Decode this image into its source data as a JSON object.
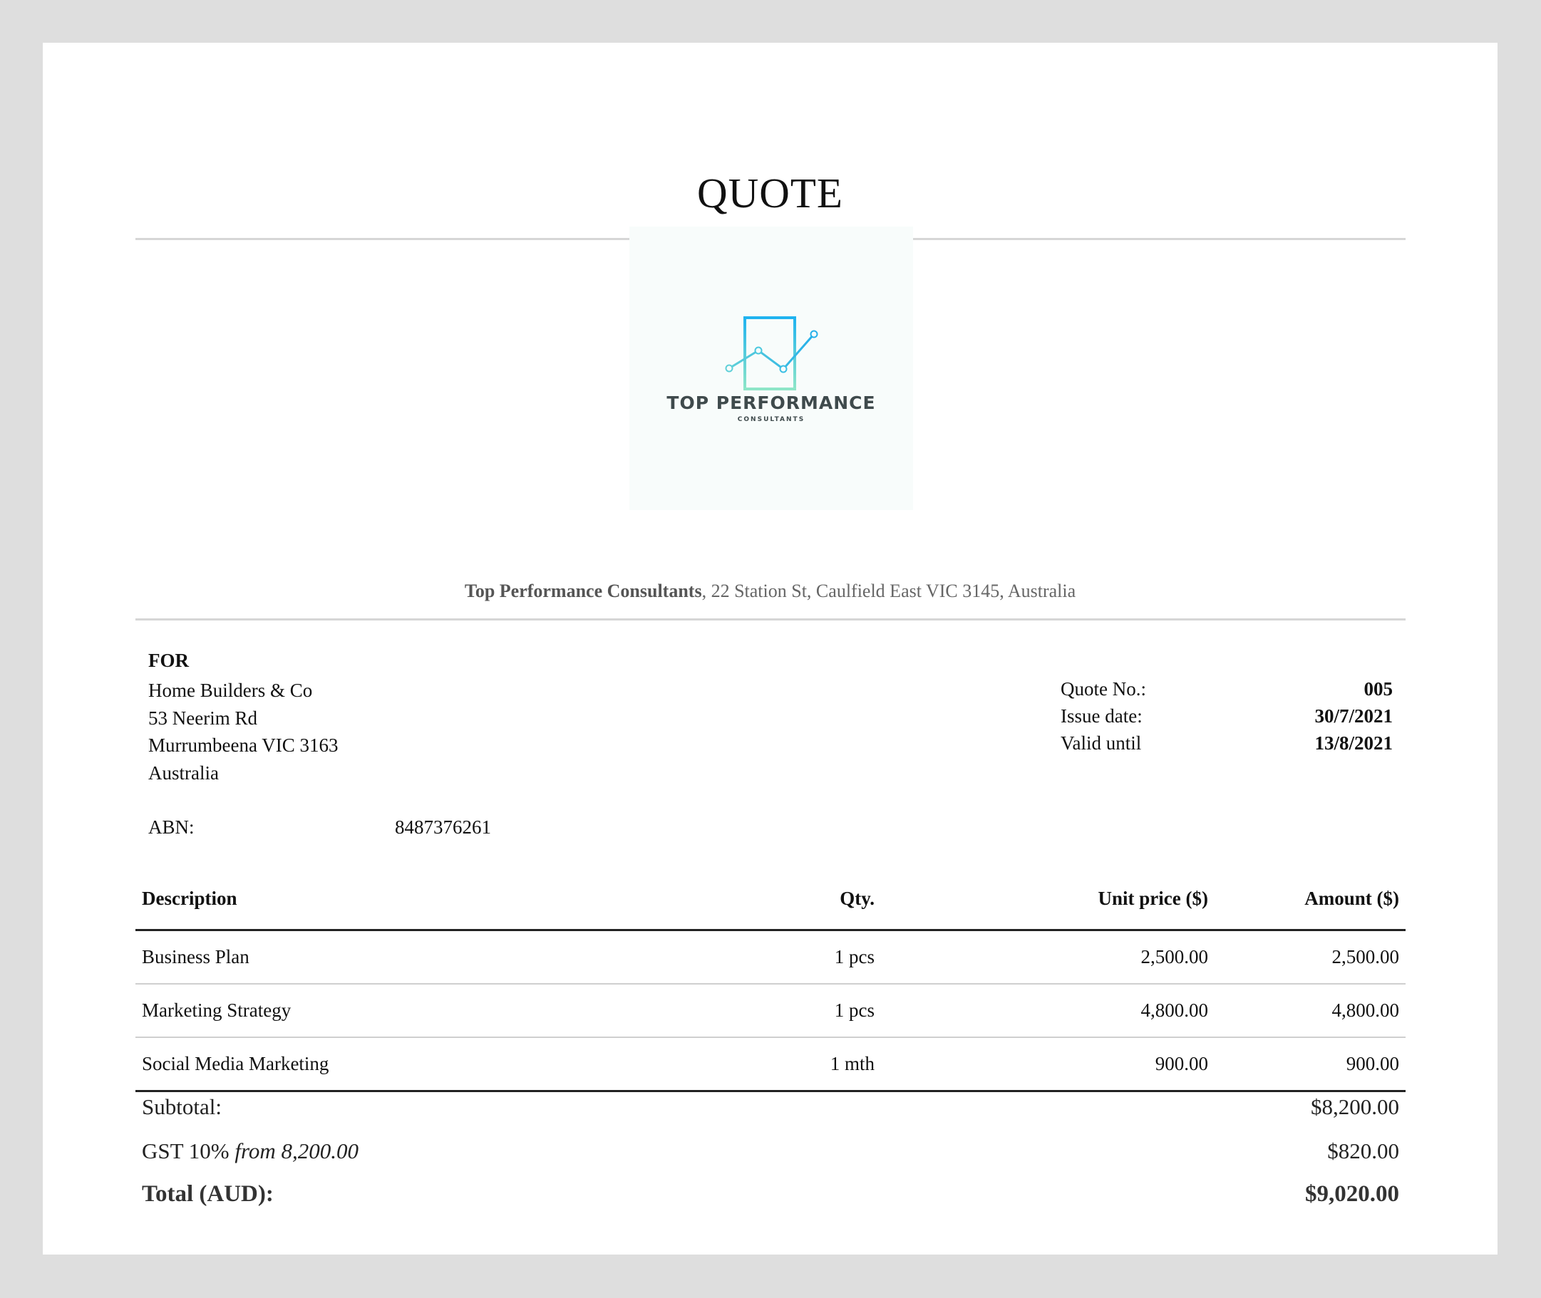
{
  "document": {
    "title": "QUOTE"
  },
  "logo": {
    "name": "TOP PERFORMANCE",
    "tagline": "CONSULTANTS",
    "colors": {
      "frame": "#2ab8ee",
      "line_start": "#5fd0d8",
      "line_end": "#26b0ea",
      "text": "#3f4a4c",
      "background": "#f8fcfb"
    }
  },
  "company": {
    "name": "Top Performance Consultants",
    "address": ", 22 Station St, Caulfield East VIC 3145, Australia"
  },
  "client": {
    "label": "FOR",
    "lines": [
      "Home Builders & Co",
      "53 Neerim Rd",
      "Murrumbeena VIC 3163",
      "Australia"
    ],
    "abn_label": "ABN:",
    "abn_value": "8487376261"
  },
  "quote_meta": [
    {
      "label": "Quote No.:",
      "value": "005"
    },
    {
      "label": "Issue date:",
      "value": "30/7/2021"
    },
    {
      "label": "Valid until",
      "value": "13/8/2021"
    }
  ],
  "items_table": {
    "headers": {
      "description": "Description",
      "qty": "Qty.",
      "unit_price": "Unit price ($)",
      "amount": "Amount ($)"
    },
    "rows": [
      {
        "description": "Business Plan",
        "qty": "1 pcs",
        "unit_price": "2,500.00",
        "amount": "2,500.00"
      },
      {
        "description": "Marketing Strategy",
        "qty": "1 pcs",
        "unit_price": "4,800.00",
        "amount": "4,800.00"
      },
      {
        "description": "Social Media Marketing",
        "qty": "1 mth",
        "unit_price": "900.00",
        "amount": "900.00"
      }
    ]
  },
  "totals": {
    "subtotal_label": "Subtotal:",
    "subtotal_value": "$8,200.00",
    "gst_label": "GST 10%",
    "gst_from": "from 8,200.00",
    "gst_value": "$820.00",
    "total_label": "Total (AUD):",
    "total_value": "$9,020.00"
  }
}
